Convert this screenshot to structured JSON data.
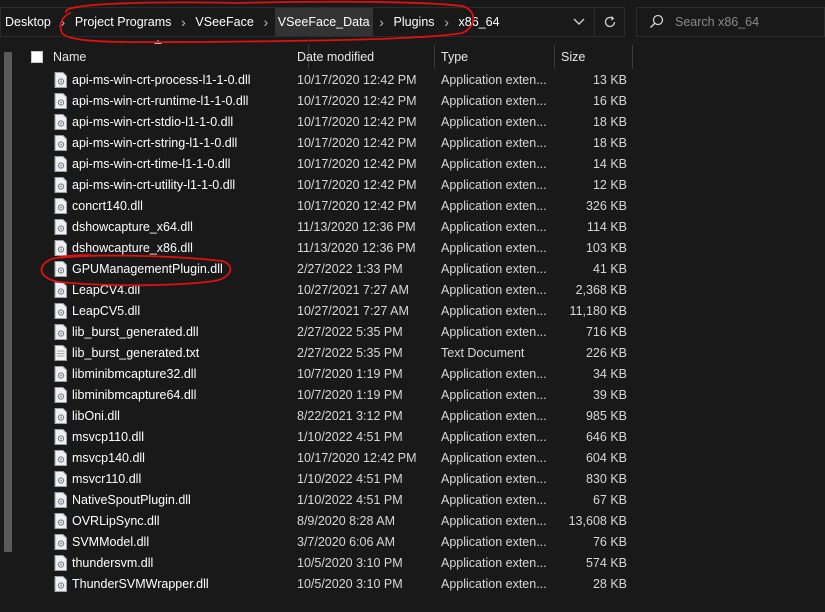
{
  "address_bar": {
    "crumbs": [
      "Desktop",
      "Project Programs",
      "VSeeFace",
      "VSeeFace_Data",
      "Plugins",
      "x86_64"
    ],
    "active_index": 3
  },
  "search": {
    "placeholder": "Search x86_64"
  },
  "columns": {
    "name": "Name",
    "date": "Date modified",
    "type": "Type",
    "size": "Size"
  },
  "files": [
    {
      "name": "api-ms-win-crt-process-l1-1-0.dll",
      "date": "10/17/2020 12:42 PM",
      "type": "Application exten...",
      "size": "13 KB",
      "icon": "dll-file-icon"
    },
    {
      "name": "api-ms-win-crt-runtime-l1-1-0.dll",
      "date": "10/17/2020 12:42 PM",
      "type": "Application exten...",
      "size": "16 KB",
      "icon": "dll-file-icon"
    },
    {
      "name": "api-ms-win-crt-stdio-l1-1-0.dll",
      "date": "10/17/2020 12:42 PM",
      "type": "Application exten...",
      "size": "18 KB",
      "icon": "dll-file-icon"
    },
    {
      "name": "api-ms-win-crt-string-l1-1-0.dll",
      "date": "10/17/2020 12:42 PM",
      "type": "Application exten...",
      "size": "18 KB",
      "icon": "dll-file-icon"
    },
    {
      "name": "api-ms-win-crt-time-l1-1-0.dll",
      "date": "10/17/2020 12:42 PM",
      "type": "Application exten...",
      "size": "14 KB",
      "icon": "dll-file-icon"
    },
    {
      "name": "api-ms-win-crt-utility-l1-1-0.dll",
      "date": "10/17/2020 12:42 PM",
      "type": "Application exten...",
      "size": "12 KB",
      "icon": "dll-file-icon"
    },
    {
      "name": "concrt140.dll",
      "date": "10/17/2020 12:42 PM",
      "type": "Application exten...",
      "size": "326 KB",
      "icon": "dll-file-icon"
    },
    {
      "name": "dshowcapture_x64.dll",
      "date": "11/13/2020 12:36 PM",
      "type": "Application exten...",
      "size": "114 KB",
      "icon": "dll-file-icon"
    },
    {
      "name": "dshowcapture_x86.dll",
      "date": "11/13/2020 12:36 PM",
      "type": "Application exten...",
      "size": "103 KB",
      "icon": "dll-file-icon"
    },
    {
      "name": "GPUManagementPlugin.dll",
      "date": "2/27/2022 1:33 PM",
      "type": "Application exten...",
      "size": "41 KB",
      "icon": "dll-file-icon"
    },
    {
      "name": "LeapCV4.dll",
      "date": "10/27/2021 7:27 AM",
      "type": "Application exten...",
      "size": "2,368 KB",
      "icon": "dll-file-icon"
    },
    {
      "name": "LeapCV5.dll",
      "date": "10/27/2021 7:27 AM",
      "type": "Application exten...",
      "size": "11,180 KB",
      "icon": "dll-file-icon"
    },
    {
      "name": "lib_burst_generated.dll",
      "date": "2/27/2022 5:35 PM",
      "type": "Application exten...",
      "size": "716 KB",
      "icon": "dll-file-icon"
    },
    {
      "name": "lib_burst_generated.txt",
      "date": "2/27/2022 5:35 PM",
      "type": "Text Document",
      "size": "226 KB",
      "icon": "text-file-icon"
    },
    {
      "name": "libminibmcapture32.dll",
      "date": "10/7/2020 1:19 PM",
      "type": "Application exten...",
      "size": "34 KB",
      "icon": "dll-file-icon"
    },
    {
      "name": "libminibmcapture64.dll",
      "date": "10/7/2020 1:19 PM",
      "type": "Application exten...",
      "size": "39 KB",
      "icon": "dll-file-icon"
    },
    {
      "name": "libOni.dll",
      "date": "8/22/2021 3:12 PM",
      "type": "Application exten...",
      "size": "985 KB",
      "icon": "dll-file-icon"
    },
    {
      "name": "msvcp110.dll",
      "date": "1/10/2022 4:51 PM",
      "type": "Application exten...",
      "size": "646 KB",
      "icon": "dll-file-icon"
    },
    {
      "name": "msvcp140.dll",
      "date": "10/17/2020 12:42 PM",
      "type": "Application exten...",
      "size": "604 KB",
      "icon": "dll-file-icon"
    },
    {
      "name": "msvcr110.dll",
      "date": "1/10/2022 4:51 PM",
      "type": "Application exten...",
      "size": "830 KB",
      "icon": "dll-file-icon"
    },
    {
      "name": "NativeSpoutPlugin.dll",
      "date": "1/10/2022 4:51 PM",
      "type": "Application exten...",
      "size": "67 KB",
      "icon": "dll-file-icon"
    },
    {
      "name": "OVRLipSync.dll",
      "date": "8/9/2020 8:28 AM",
      "type": "Application exten...",
      "size": "13,608 KB",
      "icon": "dll-file-icon"
    },
    {
      "name": "SVMModel.dll",
      "date": "3/7/2020 6:06 AM",
      "type": "Application exten...",
      "size": "76 KB",
      "icon": "dll-file-icon"
    },
    {
      "name": "thundersvm.dll",
      "date": "10/5/2020 3:10 PM",
      "type": "Application exten...",
      "size": "574 KB",
      "icon": "dll-file-icon"
    },
    {
      "name": "ThunderSVMWrapper.dll",
      "date": "10/5/2020 3:10 PM",
      "type": "Application exten...",
      "size": "28 KB",
      "icon": "dll-file-icon"
    }
  ],
  "annotation_color": "#e01010"
}
